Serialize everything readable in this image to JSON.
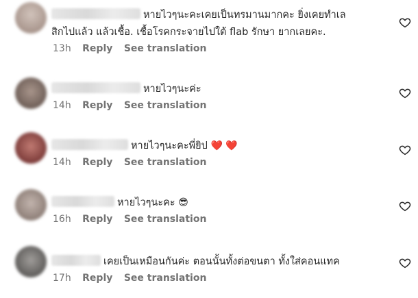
{
  "comments": [
    {
      "text_line1": "หายไวๆนะคะเคยเป็นทรมานมากคะ ยิ่งเคยทำเล",
      "text_line2": "สิกไปแล้ว แล้วเชื้อ. เชื้อโรคกระจายไปใต้ flab รักษา ยากเลยคะ.",
      "time": "13h",
      "reply": "Reply",
      "translate": "See translation",
      "avatar_color": "#b7a79f"
    },
    {
      "text_line1": "หายไวๆนะค่ะ",
      "time": "14h",
      "reply": "Reply",
      "translate": "See translation",
      "avatar_color": "#8f7f77"
    },
    {
      "text_line1": "หายไวๆนะคะพี่ยิป",
      "emoji": "❤️ ❤️",
      "time": "14h",
      "reply": "Reply",
      "translate": "See translation",
      "avatar_color": "#9a5a57"
    },
    {
      "text_line1": "หายไวๆนะคะ",
      "emoji": "😎",
      "time": "16h",
      "reply": "Reply",
      "translate": "See translation",
      "avatar_color": "#a89b95"
    },
    {
      "text_line1": "เคยเป็นเหมือนกันค่ะ ตอนนั้นทั้งต่อขนตา ทั้งใส่คอนแทค",
      "time": "17h",
      "reply": "Reply",
      "translate": "See translation",
      "avatar_color": "#7c7a78"
    }
  ],
  "icons": {
    "like": "heart-outline-icon"
  }
}
